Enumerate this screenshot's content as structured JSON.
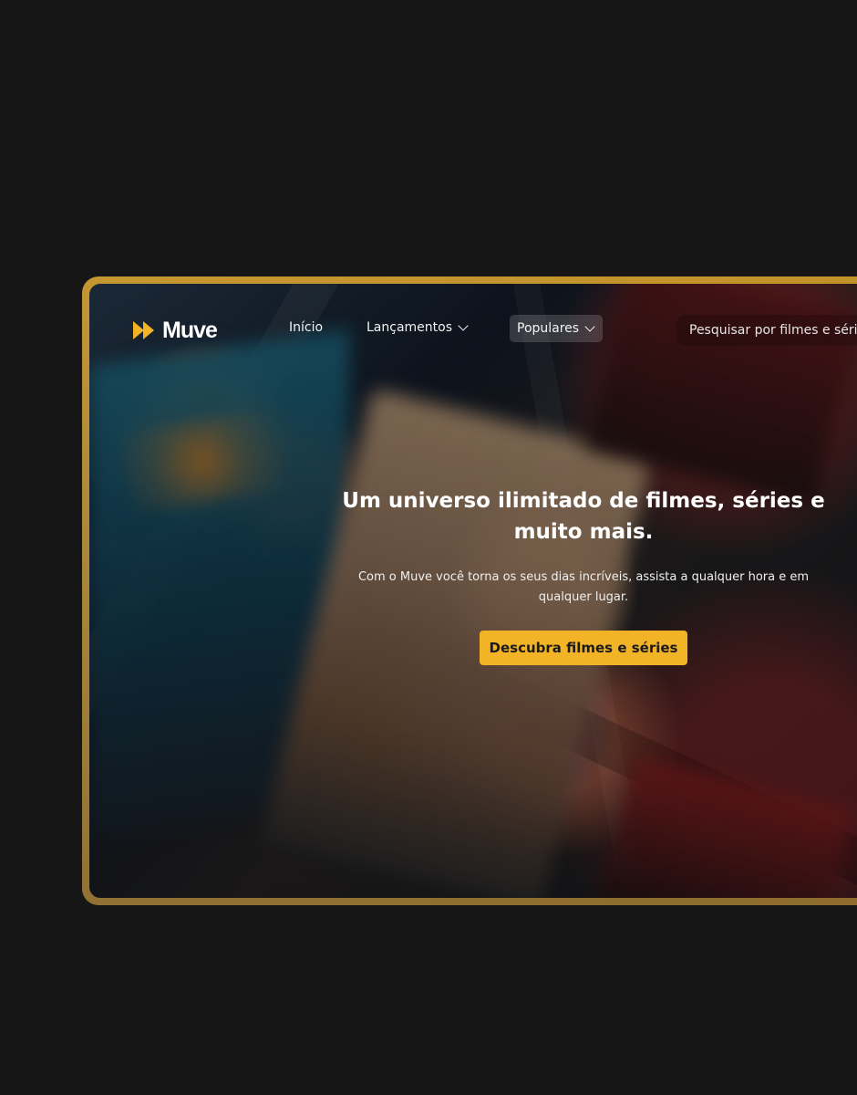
{
  "brand": {
    "name": "Muve",
    "accent_color": "#f2b326"
  },
  "nav": {
    "items": [
      {
        "label": "Início"
      },
      {
        "label": "Lançamentos"
      },
      {
        "label": "Populares"
      }
    ],
    "search_placeholder": "Pesquisar por filmes e séries"
  },
  "hero": {
    "title": "Um universo ilimitado de filmes, séries e muito mais.",
    "description": "Com o Muve você torna os seus dias incríveis, assista a qualquer hora e em qualquer lugar.",
    "cta_label": "Descubra filmes e séries"
  },
  "icons": {
    "logo": "logo-icon",
    "dropdown": "chevron-down-icon"
  }
}
